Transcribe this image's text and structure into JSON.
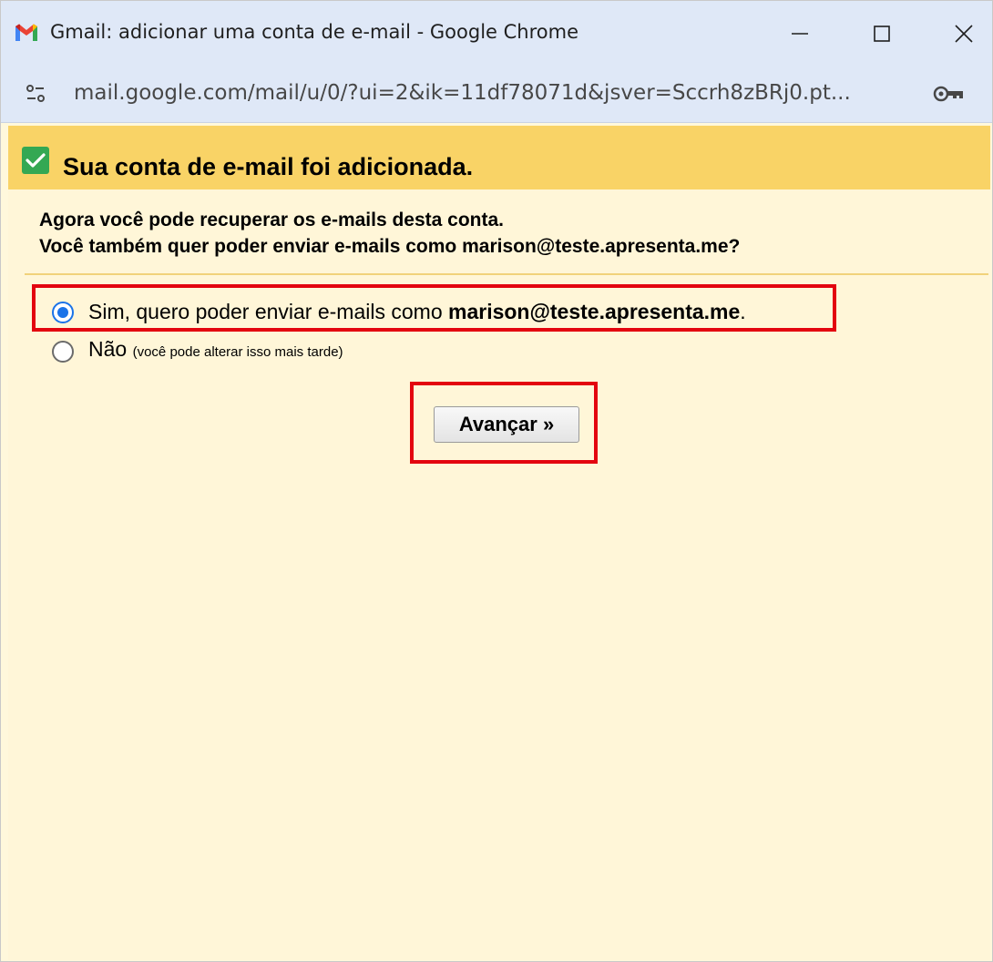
{
  "window": {
    "title": "Gmail: adicionar uma conta de e-mail - Google Chrome"
  },
  "addressbar": {
    "url": "mail.google.com/mail/u/0/?ui=2&ik=11df78071d&jsver=Sccrh8zBRj0.pt..."
  },
  "dialog": {
    "header_title": "Sua conta de e-mail foi adicionada.",
    "intro_line1": "Agora você pode recuperar os e-mails desta conta.",
    "intro_line2": "Você também quer poder enviar e-mails como marison@teste.apresenta.me?",
    "options": {
      "yes_prefix": "Sim, quero poder enviar e-mails como ",
      "yes_email": "marison@teste.apresenta.me",
      "yes_suffix": ".",
      "yes_selected": true,
      "no_label": "Não",
      "no_hint": "(você pode alterar isso mais tarde)",
      "no_selected": false
    },
    "next_button_label": "Avançar »"
  },
  "colors": {
    "header_bar": "#f9d366",
    "content_bg": "#fff6d8",
    "highlight_border": "#e3040f",
    "radio_selected": "#1a73e8"
  },
  "icons": {
    "app": "gmail-logo-icon",
    "site_info": "tune-icon",
    "password": "key-icon",
    "success": "checkbox-checked-icon"
  }
}
